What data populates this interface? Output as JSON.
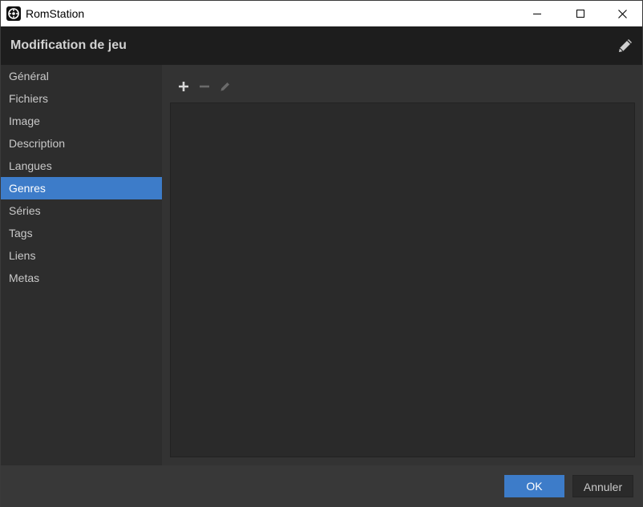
{
  "window": {
    "title": "RomStation",
    "app_icon": "romstation-logo-icon",
    "controls": [
      "minimize-icon",
      "maximize-icon",
      "close-icon"
    ]
  },
  "header": {
    "title": "Modification de jeu",
    "icon": "pencil-icon"
  },
  "sidebar": {
    "items": [
      {
        "label": "Général"
      },
      {
        "label": "Fichiers"
      },
      {
        "label": "Image"
      },
      {
        "label": "Description"
      },
      {
        "label": "Langues"
      },
      {
        "label": "Genres",
        "active": true
      },
      {
        "label": "Séries"
      },
      {
        "label": "Tags"
      },
      {
        "label": "Liens"
      },
      {
        "label": "Metas"
      }
    ]
  },
  "toolbar": {
    "buttons": [
      "plus-icon",
      "minus-icon",
      "pencil-icon"
    ]
  },
  "footer": {
    "ok_label": "OK",
    "cancel_label": "Annuler"
  },
  "colors": {
    "accent": "#3d7cc9",
    "header_bg": "#1d1d1d",
    "sidebar_bg": "#2d2d2d",
    "panel_bg": "#2a2a2a"
  }
}
